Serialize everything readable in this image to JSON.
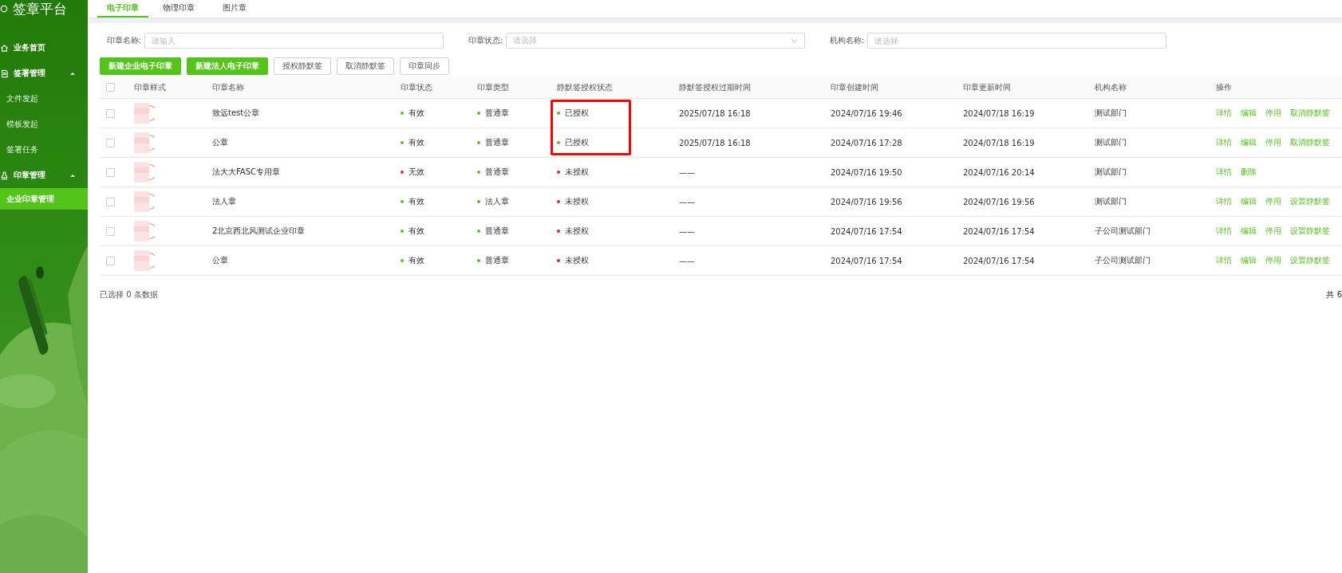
{
  "sidebar": {
    "title": "签章平台",
    "items": [
      {
        "label": "业务首页",
        "kind": "link",
        "selected": false
      },
      {
        "label": "签署管理",
        "kind": "group",
        "expanded": true,
        "children": [
          {
            "label": "文件发起",
            "selected": false
          },
          {
            "label": "模板发起",
            "selected": false
          },
          {
            "label": "签署任务",
            "selected": false
          }
        ]
      },
      {
        "label": "印章管理",
        "kind": "group",
        "expanded": true,
        "children": [
          {
            "label": "企业印章管理",
            "selected": true
          }
        ]
      }
    ]
  },
  "tabs": [
    {
      "label": "电子印章",
      "selected": true
    },
    {
      "label": "物理印章",
      "selected": false
    },
    {
      "label": "图片章",
      "selected": false
    }
  ],
  "filters": [
    {
      "label": "印章名称:",
      "kind": "input",
      "placeholder": "请输入"
    },
    {
      "label": "印章状态:",
      "kind": "select",
      "placeholder": "请选择"
    },
    {
      "label": "机构名称:",
      "kind": "input",
      "placeholder": "请选择"
    }
  ],
  "buttons": [
    {
      "label": "新建企业电子印章",
      "kind": "primary"
    },
    {
      "label": "新建法人电子印章",
      "kind": "primary"
    },
    {
      "label": "授权静默签",
      "kind": "default"
    },
    {
      "label": "取消静默签",
      "kind": "default"
    },
    {
      "label": "印章同步",
      "kind": "default"
    }
  ],
  "table": {
    "all_checked": false,
    "columns": [
      "印章样式",
      "印章名称",
      "印章状态",
      "印章类型",
      "静默签授权状态",
      "静默签授权过期时间",
      "印章创建时间",
      "印章更新时间",
      "机构名称",
      "操作"
    ],
    "rows": [
      {
        "checked": false,
        "name": "致远test公章",
        "status": {
          "label": "有效",
          "color": "#52c41a"
        },
        "type": {
          "label": "普通章",
          "color": "#52c41a"
        },
        "auth": {
          "label": "已授权",
          "color": "#52c41a"
        },
        "highlighted": true,
        "expire": "2025/07/18 16:18",
        "created": "2024/07/16 19:46",
        "updated": "2024/07/18 16:19",
        "org": "测试部门",
        "actions": [
          "详情",
          "编辑",
          "停用",
          "取消静默签"
        ]
      },
      {
        "checked": false,
        "name": "公章",
        "status": {
          "label": "有效",
          "color": "#52c41a"
        },
        "type": {
          "label": "普通章",
          "color": "#52c41a"
        },
        "auth": {
          "label": "已授权",
          "color": "#52c41a"
        },
        "highlighted": true,
        "expire": "2025/07/18 16:18",
        "created": "2024/07/16 17:28",
        "updated": "2024/07/18 16:19",
        "org": "测试部门",
        "actions": [
          "详情",
          "编辑",
          "停用",
          "取消静默签"
        ]
      },
      {
        "checked": false,
        "name": "法大大FASC专用章",
        "status": {
          "label": "无效",
          "color": "#f5222d"
        },
        "type": {
          "label": "普通章",
          "color": "#52c41a"
        },
        "auth": {
          "label": "未授权",
          "color": "#f5222d"
        },
        "highlighted": false,
        "expire": "——",
        "created": "2024/07/16 19:50",
        "updated": "2024/07/16 20:14",
        "org": "测试部门",
        "actions": [
          "详情",
          "删除"
        ]
      },
      {
        "checked": false,
        "name": "法人章",
        "status": {
          "label": "有效",
          "color": "#52c41a"
        },
        "type": {
          "label": "法人章",
          "color": "#52c41a"
        },
        "auth": {
          "label": "未授权",
          "color": "#f5222d"
        },
        "highlighted": false,
        "expire": "——",
        "created": "2024/07/16 19:56",
        "updated": "2024/07/16 19:56",
        "org": "测试部门",
        "actions": [
          "详情",
          "编辑",
          "停用",
          "设置静默签"
        ]
      },
      {
        "checked": false,
        "name": "2北京西北风测试企业印章",
        "status": {
          "label": "有效",
          "color": "#52c41a"
        },
        "type": {
          "label": "普通章",
          "color": "#52c41a"
        },
        "auth": {
          "label": "未授权",
          "color": "#f5222d"
        },
        "highlighted": false,
        "expire": "——",
        "created": "2024/07/16 17:54",
        "updated": "2024/07/16 17:54",
        "org": "子公司测试部门",
        "actions": [
          "详情",
          "编辑",
          "停用",
          "设置静默签"
        ]
      },
      {
        "checked": false,
        "name": "公章",
        "status": {
          "label": "有效",
          "color": "#52c41a"
        },
        "type": {
          "label": "普通章",
          "color": "#52c41a"
        },
        "auth": {
          "label": "未授权",
          "color": "#f5222d"
        },
        "highlighted": false,
        "expire": "——",
        "created": "2024/07/16 17:54",
        "updated": "2024/07/16 17:54",
        "org": "子公司测试部门",
        "actions": [
          "详情",
          "编辑",
          "停用",
          "设置静默签"
        ]
      }
    ]
  },
  "footer": {
    "selection": "已选择 0 条数据",
    "total": "共 6"
  }
}
